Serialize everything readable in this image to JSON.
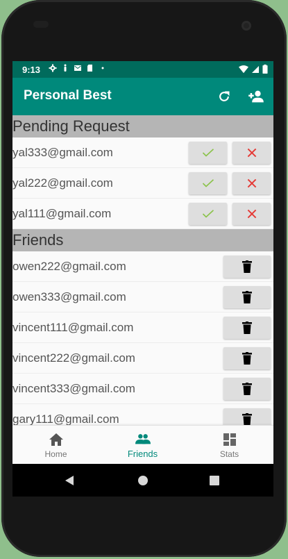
{
  "status_bar": {
    "time": "9:13"
  },
  "app_bar": {
    "title": "Personal Best",
    "icons": [
      "refresh-icon",
      "add-friend-icon"
    ]
  },
  "pending": {
    "header": "Pending Request",
    "items": [
      {
        "email": "yal333@gmail.com"
      },
      {
        "email": "yal222@gmail.com"
      },
      {
        "email": "yal111@gmail.com"
      }
    ]
  },
  "friends": {
    "header": "Friends",
    "items": [
      {
        "email": "owen222@gmail.com"
      },
      {
        "email": "owen333@gmail.com"
      },
      {
        "email": "vincent111@gmail.com"
      },
      {
        "email": "vincent222@gmail.com"
      },
      {
        "email": "vincent333@gmail.com"
      },
      {
        "email": "gary111@gmail.com"
      }
    ]
  },
  "bottom_nav": {
    "items": [
      {
        "label": "Home",
        "icon": "home-icon"
      },
      {
        "label": "Friends",
        "icon": "people-icon",
        "active": true
      },
      {
        "label": "Stats",
        "icon": "dashboard-icon"
      }
    ]
  },
  "colors": {
    "primary": "#00897b",
    "status_bar": "#006b5c",
    "accept": "#8bc34a",
    "reject": "#e53935"
  }
}
